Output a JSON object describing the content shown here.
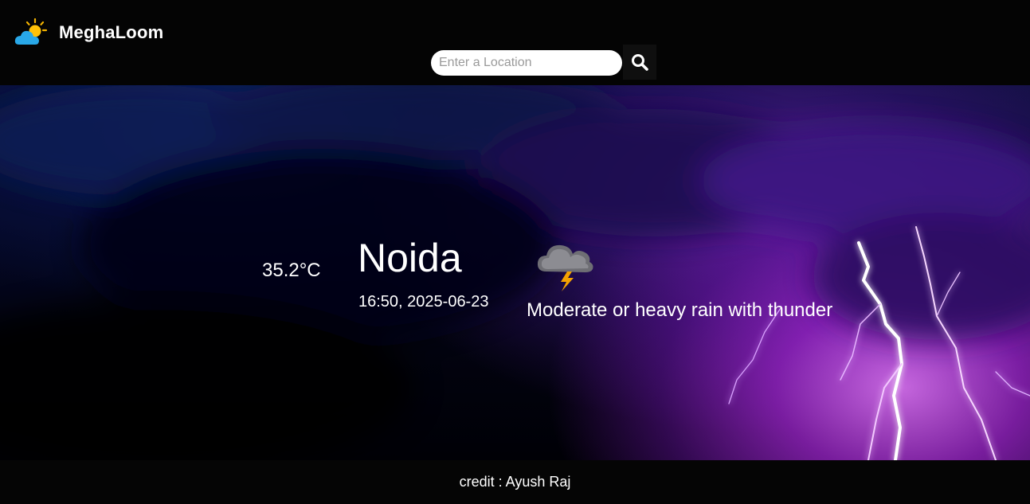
{
  "header": {
    "brand_name": "MeghaLoom",
    "logo_icon": "sun-behind-cloud-icon"
  },
  "search": {
    "placeholder": "Enter a Location",
    "value": "",
    "button_icon": "search-icon"
  },
  "weather": {
    "temperature": "35.2°C",
    "city": "Noida",
    "datetime": "16:50, 2025-06-23",
    "condition": "Moderate or heavy rain with thunder",
    "condition_icon": "thunderstorm-cloud-icon"
  },
  "footer": {
    "credit": "credit : Ayush Raj"
  },
  "colors": {
    "header_bg": "#040404",
    "footer_bg": "#050505",
    "text": "#ffffff",
    "storm_purple": "#a028dc",
    "storm_navy": "#081034"
  }
}
